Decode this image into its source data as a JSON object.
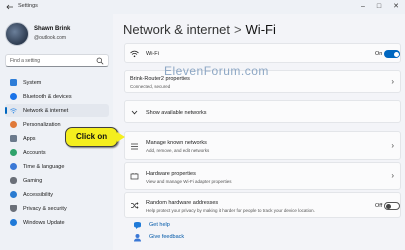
{
  "window": {
    "title": "Settings"
  },
  "user": {
    "name": "Shawn Brink",
    "email": "@outlook.com"
  },
  "search": {
    "placeholder": "Find a setting"
  },
  "sidebar": {
    "items": [
      {
        "label": "System",
        "icon": "monitor-icon",
        "color": "#2e7dd7"
      },
      {
        "label": "Bluetooth & devices",
        "icon": "bluetooth-icon",
        "color": "#1a73e8"
      },
      {
        "label": "Network & internet",
        "icon": "wifi-icon",
        "color": "#3a8ee6",
        "active": true
      },
      {
        "label": "Personalization",
        "icon": "brush-icon",
        "color": "#e07a3a"
      },
      {
        "label": "Apps",
        "icon": "apps-icon",
        "color": "#6b7a8c"
      },
      {
        "label": "Accounts",
        "icon": "person-icon",
        "color": "#2fa36b"
      },
      {
        "label": "Time & language",
        "icon": "clock-globe-icon",
        "color": "#3a78d6"
      },
      {
        "label": "Gaming",
        "icon": "gamepad-icon",
        "color": "#6a6f78"
      },
      {
        "label": "Accessibility",
        "icon": "accessibility-icon",
        "color": "#2a7bd1"
      },
      {
        "label": "Privacy & security",
        "icon": "shield-icon",
        "color": "#6a6f78"
      },
      {
        "label": "Windows Update",
        "icon": "update-icon",
        "color": "#1f7ad8"
      }
    ]
  },
  "breadcrumb": {
    "parent": "Network & internet",
    "separator": ">",
    "current": "Wi-Fi"
  },
  "watermark": "ElevenForum.com",
  "wifi_row": {
    "title": "Wi-Fi",
    "toggle_state": "On",
    "on": true
  },
  "network_props": {
    "title": "Brink-Router2 properties",
    "subtitle": "Connected, secured"
  },
  "show_networks": {
    "title": "Show available networks"
  },
  "manage_networks": {
    "title": "Manage known networks",
    "subtitle": "Add, remove, and edit networks"
  },
  "hardware_props": {
    "title": "Hardware properties",
    "subtitle": "View and manage Wi-Fi adapter properties"
  },
  "random_mac": {
    "title": "Random hardware addresses",
    "subtitle": "Help protect your privacy by making it harder for people to track your device location.",
    "toggle_state": "Off",
    "on": false
  },
  "links": {
    "help": "Get help",
    "feedback": "Give feedback"
  },
  "callout": {
    "text": "Click on"
  },
  "colors": {
    "accent": "#0067c0",
    "callout": "#f4ee1e"
  }
}
